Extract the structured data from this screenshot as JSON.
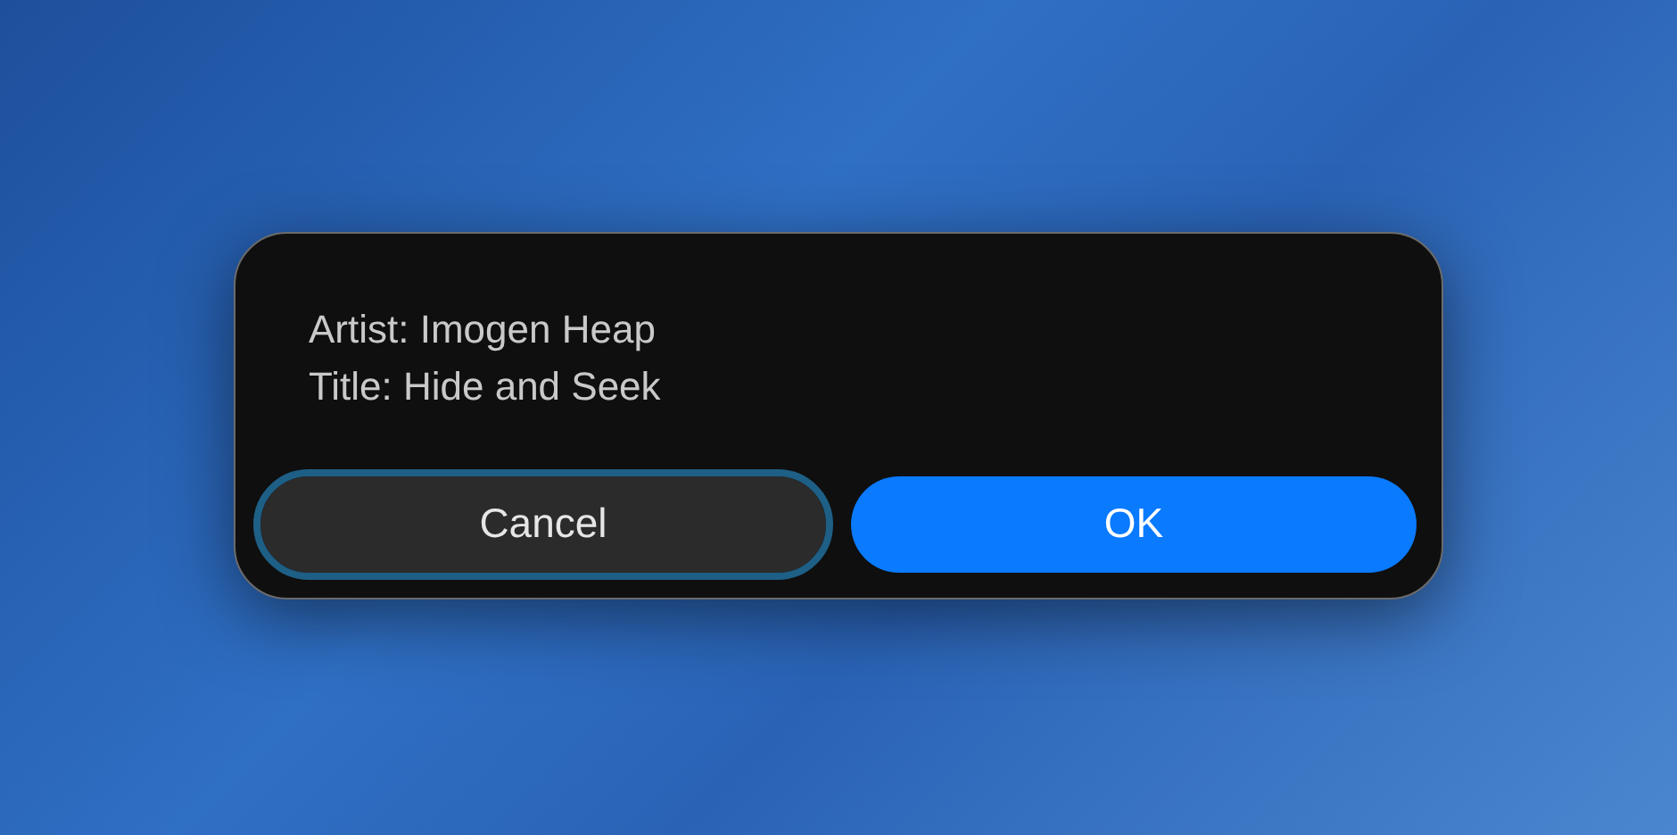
{
  "dialog": {
    "lines": [
      "Artist: Imogen Heap",
      "Title: Hide and Seek"
    ],
    "buttons": [
      {
        "label": "Cancel",
        "kind": "secondary",
        "focused": true
      },
      {
        "label": "OK",
        "kind": "primary",
        "focused": false
      }
    ]
  }
}
